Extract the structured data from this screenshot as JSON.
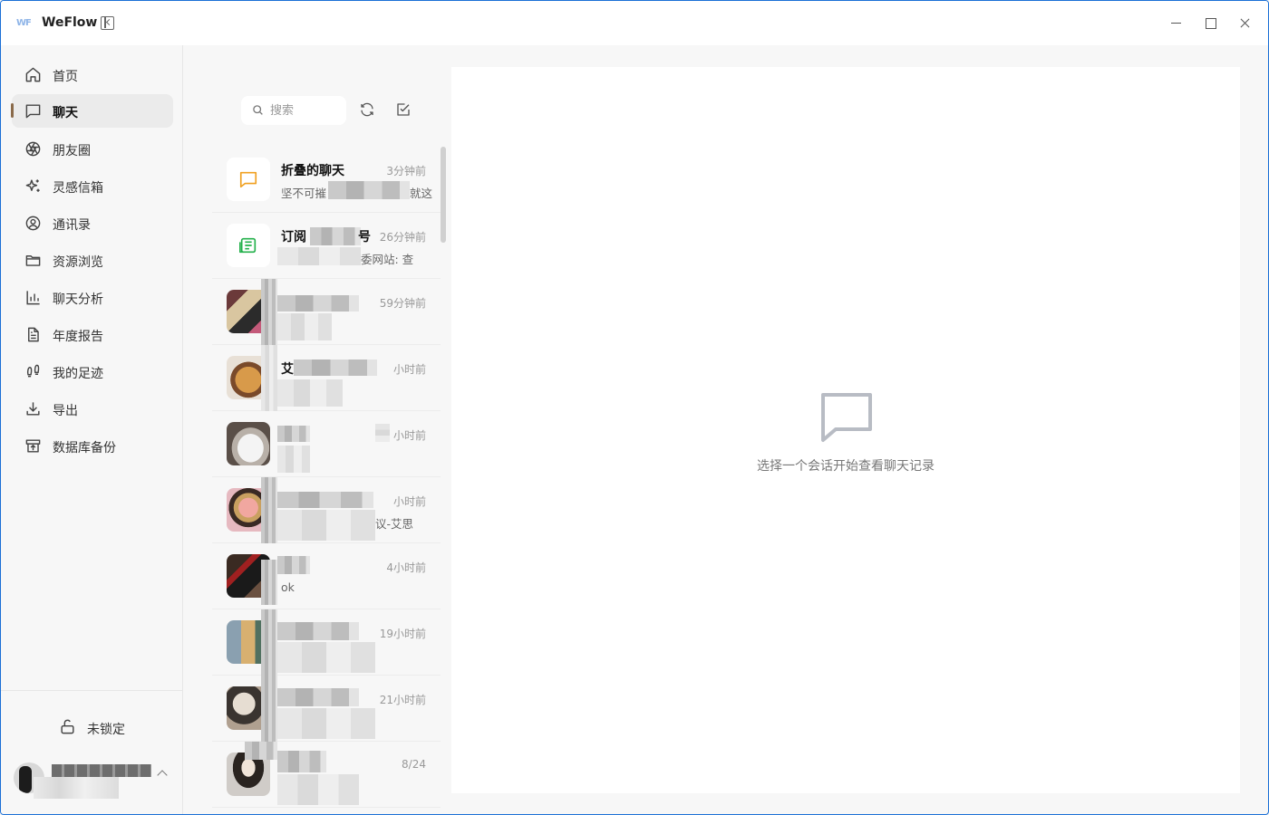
{
  "app": {
    "title": "WeFlow",
    "logo_text": "WF"
  },
  "window_controls": {
    "minimize": "minimize-icon",
    "maximize": "maximize-icon",
    "close": "close-icon"
  },
  "nav": {
    "items": [
      {
        "label": "首页",
        "icon": "home-icon"
      },
      {
        "label": "聊天",
        "icon": "chat-icon",
        "active": true
      },
      {
        "label": "朋友圈",
        "icon": "aperture-icon"
      },
      {
        "label": "灵感信箱",
        "icon": "sparkles-icon"
      },
      {
        "label": "通讯录",
        "icon": "contact-icon"
      },
      {
        "label": "资源浏览",
        "icon": "folder-icon"
      },
      {
        "label": "聊天分析",
        "icon": "bar-chart-icon"
      },
      {
        "label": "年度报告",
        "icon": "report-icon"
      },
      {
        "label": "我的足迹",
        "icon": "footprints-icon"
      },
      {
        "label": "导出",
        "icon": "download-icon"
      },
      {
        "label": "数据库备份",
        "icon": "archive-icon"
      }
    ],
    "lock_label": "未锁定"
  },
  "search": {
    "placeholder": "搜索"
  },
  "sessions": [
    {
      "name": "折叠的聊天",
      "time": "3分钟前",
      "preview": "坚不可摧",
      "preview_tail": "就这"
    },
    {
      "name": "订阅",
      "name_tail": "号",
      "time": "26分钟前",
      "preview_tail": "委网站: 查"
    },
    {
      "name": "",
      "time": "59分钟前",
      "preview": ""
    },
    {
      "name": "艾",
      "time": "小时前",
      "preview": ""
    },
    {
      "name": "",
      "time": "小时前",
      "preview": ""
    },
    {
      "name": "",
      "time": "小时前",
      "preview_tail": "议-艾思"
    },
    {
      "name": "",
      "time": "4小时前",
      "preview": "ok"
    },
    {
      "name": "",
      "time": "19小时前",
      "preview": ""
    },
    {
      "name": "",
      "time": "21小时前",
      "preview": ""
    },
    {
      "name": "",
      "time": "8/24",
      "preview": ""
    }
  ],
  "chat": {
    "empty_text": "选择一个会话开始查看聊天记录"
  },
  "colors": {
    "accent": "#8a6a4a",
    "folded_icon": "#f0a020",
    "subscription_icon": "#22b04a"
  }
}
